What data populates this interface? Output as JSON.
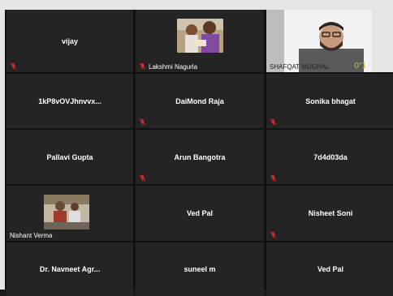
{
  "participants": [
    {
      "name": "vijay"
    },
    {
      "name": "Lakshmi Nagurla"
    },
    {
      "name": "SHAFQAT MUGHAL"
    },
    {
      "name": "1kP8vOVJhnvvx..."
    },
    {
      "name": "DaiMond Raja"
    },
    {
      "name": "Sonika bhagat"
    },
    {
      "name": "Pallavi Gupta"
    },
    {
      "name": "Arun Bangotra"
    },
    {
      "name": "7d4d03da"
    },
    {
      "name": "Nishant Verma"
    },
    {
      "name": "Ved Pal"
    },
    {
      "name": "Nisheet Soni"
    },
    {
      "name": "Dr. Navneet Agr..."
    },
    {
      "name": "suneel m"
    },
    {
      "name": "Ved Pal"
    }
  ],
  "colors": {
    "tile_bg": "#242424",
    "mute_red": "#e02828",
    "frame_bg": "#e6e6e6"
  },
  "icons": {
    "mute": "microphone-muted-icon"
  }
}
